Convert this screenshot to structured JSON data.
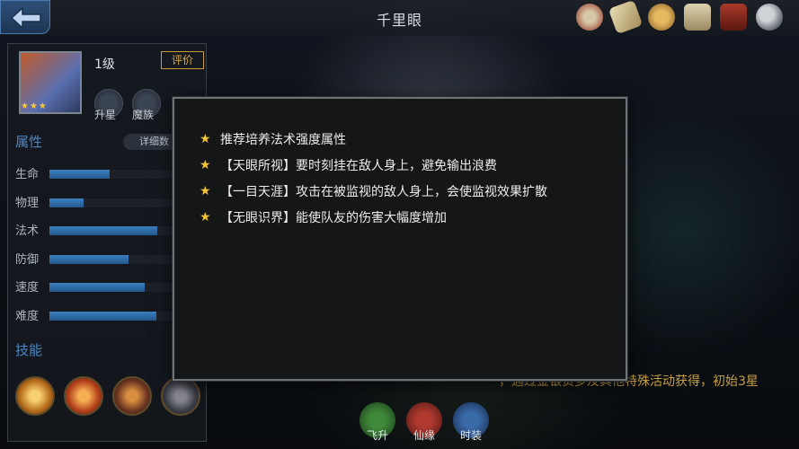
{
  "header": {
    "title": "千里眼",
    "back_icon": "back-arrow-icon"
  },
  "toolbar_icons": [
    "compass-icon",
    "scroll-icon",
    "coin-icon",
    "map-icon",
    "book-icon",
    "magnifier-icon"
  ],
  "hero": {
    "level": "1级",
    "rate_label": "评价",
    "stars": "★★★",
    "upgrade_label": "升星",
    "faction_label": "魔族"
  },
  "attributes": {
    "title": "属性",
    "detail_label": "详细数",
    "items": [
      {
        "label": "生命",
        "value": 0.48
      },
      {
        "label": "物理",
        "value": 0.27
      },
      {
        "label": "法术",
        "value": 0.86
      },
      {
        "label": "防御",
        "value": 0.63
      },
      {
        "label": "速度",
        "value": 0.76
      },
      {
        "label": "难度",
        "value": 0.85
      }
    ]
  },
  "skills": {
    "title": "技能"
  },
  "bottom": {
    "note": "，通过金银货多及其他特殊活动获得，初始3星",
    "buttons": [
      "飞升",
      "仙缘",
      "时装"
    ]
  },
  "tips": [
    "推荐培养法术强度属性",
    "【天眼所视】要时刻挂在敌人身上，避免输出浪费",
    "【一目天涯】攻击在被监视的敌人身上，会使监视效果扩散",
    "【无眼识界】能使队友的伤害大幅度增加"
  ],
  "colors": {
    "star": "#f2c43a",
    "section": "#4d86c5",
    "accent": "#c9a046"
  }
}
